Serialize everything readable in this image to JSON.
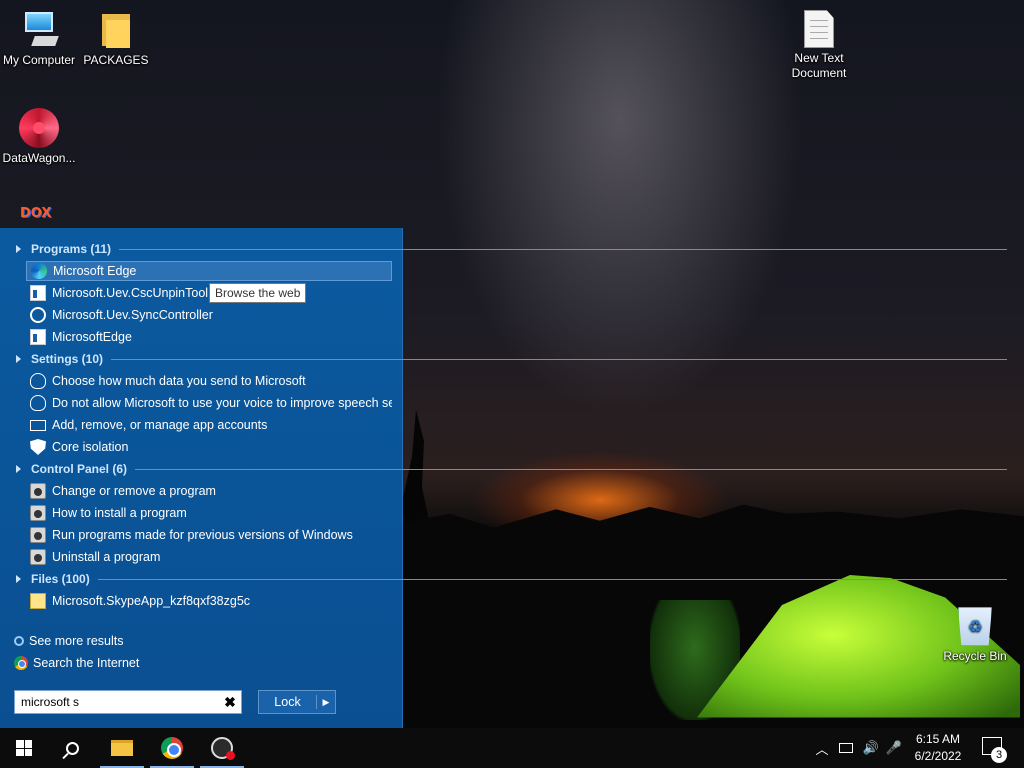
{
  "desktop": {
    "icons": {
      "my_computer": "My Computer",
      "packages": "PACKAGES",
      "datawagon": "DataWagon...",
      "new_text_document_line1": "New Text",
      "new_text_document_line2": "Document",
      "recycle_bin": "Recycle Bin",
      "dox_partial": "DOX"
    }
  },
  "start_search": {
    "groups": {
      "programs": "Programs (11)",
      "settings": "Settings (10)",
      "control_panel": "Control Panel (6)",
      "files": "Files (100)"
    },
    "programs": [
      "Microsoft Edge",
      "Microsoft.Uev.CscUnpinTool",
      "Microsoft.Uev.SyncController",
      "MicrosoftEdge"
    ],
    "settings": [
      "Choose how much data you send to Microsoft",
      "Do not allow Microsoft to use your voice to improve speech se...",
      "Add, remove, or manage app accounts",
      "Core isolation"
    ],
    "control_panel": [
      "Change or remove a program",
      "How to install a program",
      "Run programs made for previous versions of Windows",
      "Uninstall a program"
    ],
    "files": [
      "Microsoft.SkypeApp_kzf8qxf38zg5c"
    ],
    "tooltip": "Browse the web",
    "see_more_results": "See more results",
    "search_internet": "Search the Internet",
    "search_value": "microsoft s",
    "clear_glyph": "✖",
    "lock_label": "Lock",
    "lock_arrow": "▶"
  },
  "taskbar": {
    "time": "6:15 AM",
    "date": "6/2/2022",
    "notification_count": "3",
    "tray_chevron": "︿",
    "tray_speaker": "🔊",
    "tray_mic": "🎤"
  },
  "colors": {
    "panel": "#0b5aa0",
    "selected": "#2d71b5",
    "taskbar": "#0c0c0c"
  }
}
